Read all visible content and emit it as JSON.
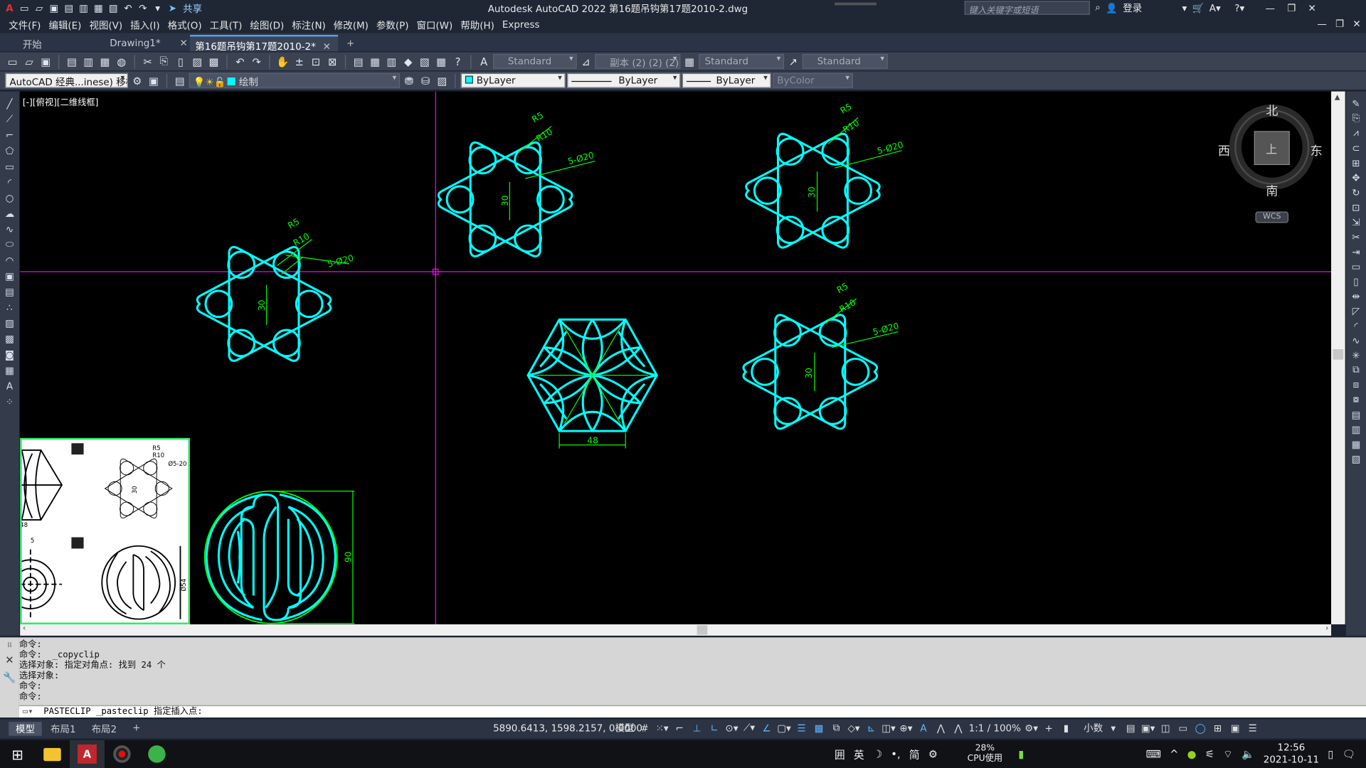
{
  "title_bar": {
    "window_title": "Autodesk AutoCAD 2022    第16题吊钩第17题2010-2.dwg",
    "share_label": "共享",
    "search_placeholder": "键入关键字或短语",
    "login_label": "登录"
  },
  "menu": [
    "文件(F)",
    "编辑(E)",
    "视图(V)",
    "插入(I)",
    "格式(O)",
    "工具(T)",
    "绘图(D)",
    "标注(N)",
    "修改(M)",
    "参数(P)",
    "窗口(W)",
    "帮助(H)",
    "Express"
  ],
  "tabs": {
    "start": "开始",
    "drawing1": "Drawing1*",
    "active": "第16题吊钩第17题2010-2*"
  },
  "toolbar1": {
    "text_style": "Standard",
    "dim_style": "副本 (2) (2) (2)",
    "table_style": "Standard",
    "mleader_style": "Standard"
  },
  "toolbar2": {
    "workspace": "AutoCAD 经典...inese) 移植",
    "layer": "绘制",
    "color": "ByLayer",
    "linetype": "ByLayer",
    "lineweight": "ByLayer",
    "plotstyle": "ByColor"
  },
  "viewport": {
    "label": "[-][俯视][二维线框]",
    "compass": {
      "n": "北",
      "s": "南",
      "e": "东",
      "w": "西",
      "top": "上"
    },
    "wcs": "WCS"
  },
  "drawing_labels": {
    "r5": "R5",
    "r10": "R10",
    "holes": "5-Ø20",
    "dim30": "30",
    "dim48": "48",
    "dim90": "90",
    "ref_r5": "R5",
    "ref_r10": "R10",
    "ref_holes": "Ø5-20",
    "ref_dim30": "30",
    "ref_dim_right": "Ø54",
    "ref_dim_left": "48",
    "ref_5": "5"
  },
  "command_history": [
    "命令:",
    "命令:  _copyclip",
    "选择对象: 指定对角点: 找到 24 个",
    "选择对象:",
    "命令:",
    "命令:"
  ],
  "command_input": "PASTECLIP _pasteclip 指定插入点:",
  "status": {
    "layouts": [
      "模型",
      "布局1",
      "布局2"
    ],
    "coordinates": "5890.6413, 1598.2157, 0.0000",
    "model": "模型",
    "scale": "1:1 / 100%",
    "units": "小数"
  },
  "taskbar": {
    "cpu_pct": "28%",
    "cpu_label": "CPU使用",
    "time": "12:56",
    "date": "2021-10-11",
    "ime": "英",
    "ime2": "简"
  },
  "colors": {
    "cyan": "#00ffff",
    "green": "#00ff00",
    "magenta": "#ff00ff"
  }
}
